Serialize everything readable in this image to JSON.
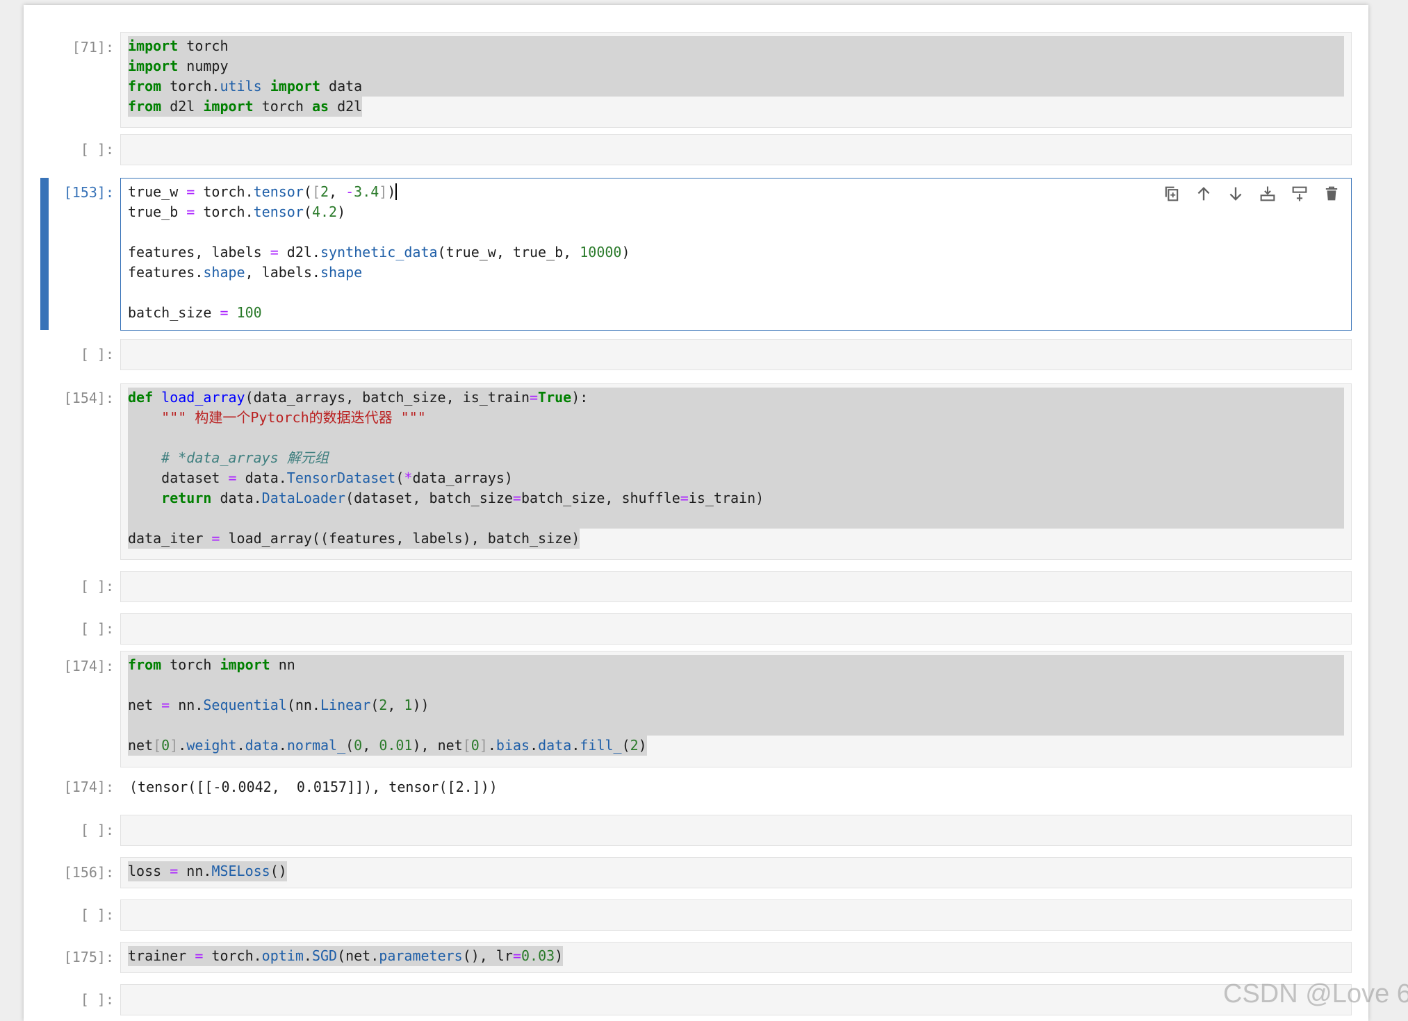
{
  "watermark": "CSDN @Love 6",
  "cells": {
    "c71": {
      "prompt": "[71]:",
      "lines": [
        "import torch",
        "import numpy",
        "from torch.utils import data",
        "from d2l import torch as d2l"
      ]
    },
    "empty1": {
      "prompt": "[ ]:"
    },
    "c153": {
      "prompt": "[153]:",
      "lines": [
        "true_w = torch.tensor([2, -3.4])",
        "true_b = torch.tensor(4.2)",
        "",
        "features, labels = d2l.synthetic_data(true_w, true_b, 10000)",
        "features.shape, labels.shape",
        "",
        "batch_size = 100"
      ],
      "toolbar": [
        "duplicate-icon",
        "move-up-icon",
        "move-down-icon",
        "insert-below-icon",
        "insert-above-icon",
        "delete-icon"
      ]
    },
    "empty2": {
      "prompt": "[ ]:"
    },
    "c154": {
      "prompt": "[154]:",
      "lines": [
        "def load_array(data_arrays, batch_size, is_train=True):",
        "    \"\"\" 构建一个Pytorch的数据迭代器 \"\"\"",
        "",
        "    # *data_arrays 解元组",
        "    dataset = data.TensorDataset(*data_arrays)",
        "    return data.DataLoader(dataset, batch_size=batch_size, shuffle=is_train)",
        "",
        "data_iter = load_array((features, labels), batch_size)"
      ]
    },
    "empty3": {
      "prompt": "[ ]:"
    },
    "empty4": {
      "prompt": "[ ]:"
    },
    "c174": {
      "prompt": "[174]:",
      "lines": [
        "from torch import nn",
        "",
        "net = nn.Sequential(nn.Linear(2, 1))",
        "",
        "net[0].weight.data.normal_(0, 0.01), net[0].bias.data.fill_(2)"
      ],
      "output_prompt": "[174]:",
      "output": "(tensor([[-0.0042,  0.0157]]), tensor([2.]))"
    },
    "empty5": {
      "prompt": "[ ]:"
    },
    "c156": {
      "prompt": "[156]:",
      "lines": [
        "loss = nn.MSELoss()"
      ]
    },
    "empty6": {
      "prompt": "[ ]:"
    },
    "c175": {
      "prompt": "[175]:",
      "lines": [
        "trainer = torch.optim.SGD(net.parameters(), lr=0.03)"
      ]
    },
    "empty7": {
      "prompt": "[ ]:"
    }
  }
}
